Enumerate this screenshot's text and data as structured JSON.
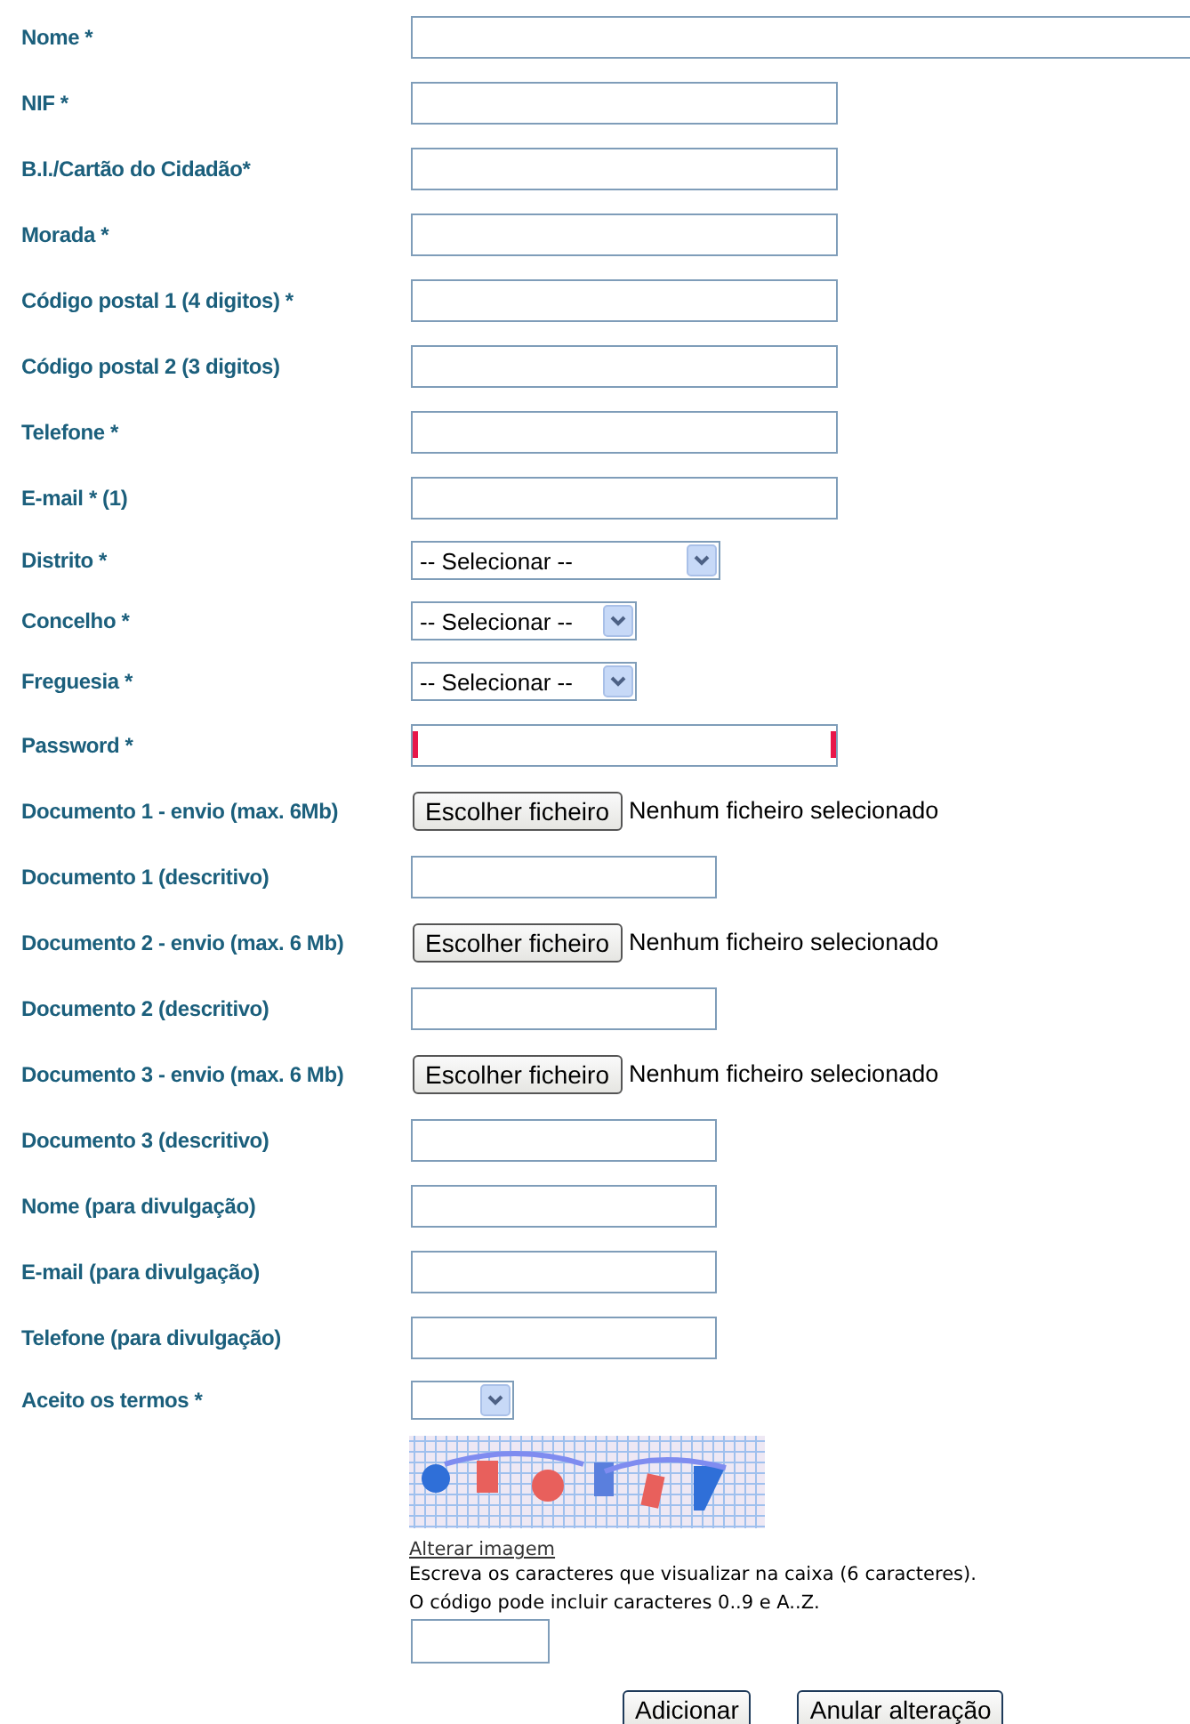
{
  "form": {
    "rows": [
      {
        "label": "Nome *",
        "kind": "text",
        "invalid": false
      },
      {
        "label": "NIF *",
        "kind": "text",
        "invalid": false
      },
      {
        "label": "B.I./Cartão do Cidadão*",
        "kind": "text",
        "invalid": false
      },
      {
        "label": "Morada *",
        "kind": "text",
        "invalid": false
      },
      {
        "label": "Código postal 1 (4 digitos) *",
        "kind": "text",
        "invalid": false
      },
      {
        "label": "Código postal 2 (3 digitos)",
        "kind": "text",
        "invalid": false
      },
      {
        "label": "Telefone *",
        "kind": "text",
        "invalid": false
      },
      {
        "label": "E-mail * (1)",
        "kind": "text",
        "invalid": false
      },
      {
        "label": "Distrito *",
        "kind": "select",
        "value": "-- Selecionar --",
        "invalid": false
      },
      {
        "label": "Concelho *",
        "kind": "select",
        "value": "-- Selecionar --",
        "invalid": false
      },
      {
        "label": "Freguesia *",
        "kind": "select",
        "value": "-- Selecionar --",
        "invalid": false
      },
      {
        "label": "Password *",
        "kind": "password",
        "invalid": true
      },
      {
        "label": "Documento 1 - envio (max. 6Mb)",
        "kind": "file",
        "button": "Escolher ficheiro",
        "status": "Nenhum ficheiro selecionado",
        "invalid": false
      },
      {
        "label": "Documento 1 (descritivo)",
        "kind": "text",
        "invalid": false
      },
      {
        "label": "Documento 2 - envio (max. 6 Mb)",
        "kind": "file",
        "button": "Escolher ficheiro",
        "status": "Nenhum ficheiro selecionado",
        "invalid": false
      },
      {
        "label": "Documento 2 (descritivo)",
        "kind": "text",
        "invalid": false
      },
      {
        "label": "Documento 3 - envio (max. 6 Mb)",
        "kind": "file",
        "button": "Escolher ficheiro",
        "status": "Nenhum ficheiro selecionado",
        "invalid": false
      },
      {
        "label": "Documento 3 (descritivo)",
        "kind": "text",
        "invalid": false
      },
      {
        "label": "Nome (para divulgação)",
        "kind": "text",
        "invalid": false
      },
      {
        "label": "E-mail (para divulgação)",
        "kind": "text",
        "invalid": false
      },
      {
        "label": "Telefone (para divulgação)",
        "kind": "text",
        "invalid": false
      },
      {
        "label": "Aceito os termos *",
        "kind": "select",
        "invalid": false
      }
    ]
  },
  "captcha": {
    "link": "Alterar imagem",
    "instructions": [
      "Escreva os caracteres que visualizar na caixa (6 caracteres).",
      "O código pode incluir caracteres 0..9 e A..Z."
    ]
  },
  "buttons": [
    "Adicionar",
    "Anular alteração"
  ]
}
